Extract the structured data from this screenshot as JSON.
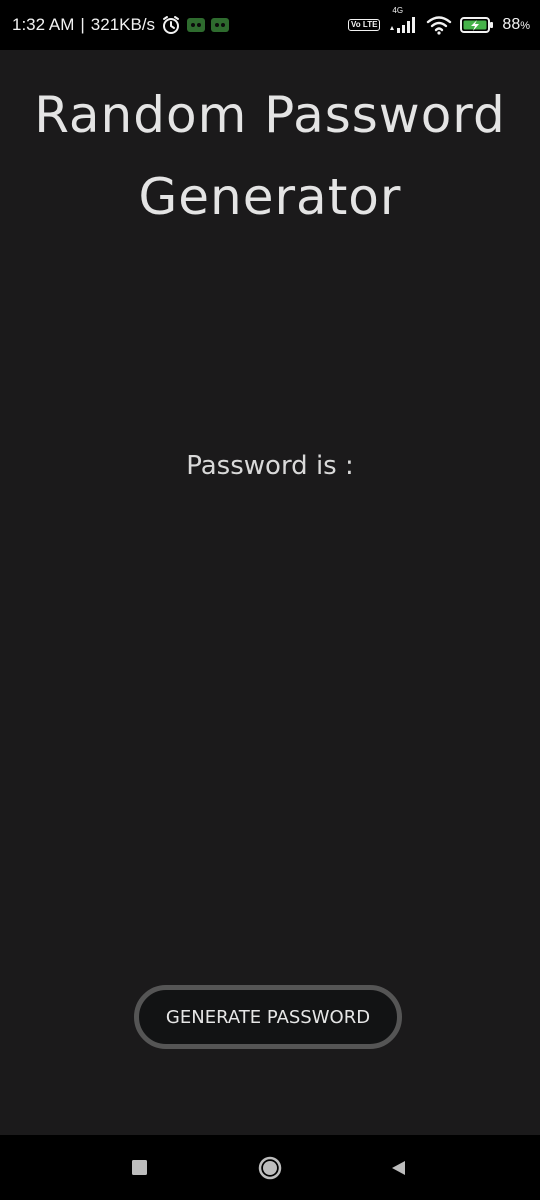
{
  "status_bar": {
    "time": "1:32 AM",
    "separator": "|",
    "network_speed": "321KB/s",
    "volte_label": "Vo LTE",
    "network_type": "4G",
    "battery_percent": "88",
    "battery_unit": "%",
    "icons": [
      "alarm-icon",
      "app-notification-icon",
      "app-notification-icon",
      "volte-icon",
      "signal-icon",
      "wifi-icon",
      "battery-charging-icon"
    ]
  },
  "app": {
    "title_line1": "Random Password",
    "title_line2": "Generator",
    "password_label": "Password is :",
    "generate_button": "GENERATE PASSWORD",
    "colors": {
      "background": "#1b1a1b",
      "text": "#e4e4e4",
      "button_border": "#555555",
      "button_fill": "#121314"
    }
  },
  "nav_bar": {
    "buttons": [
      "recents-icon",
      "home-icon",
      "back-icon"
    ]
  }
}
